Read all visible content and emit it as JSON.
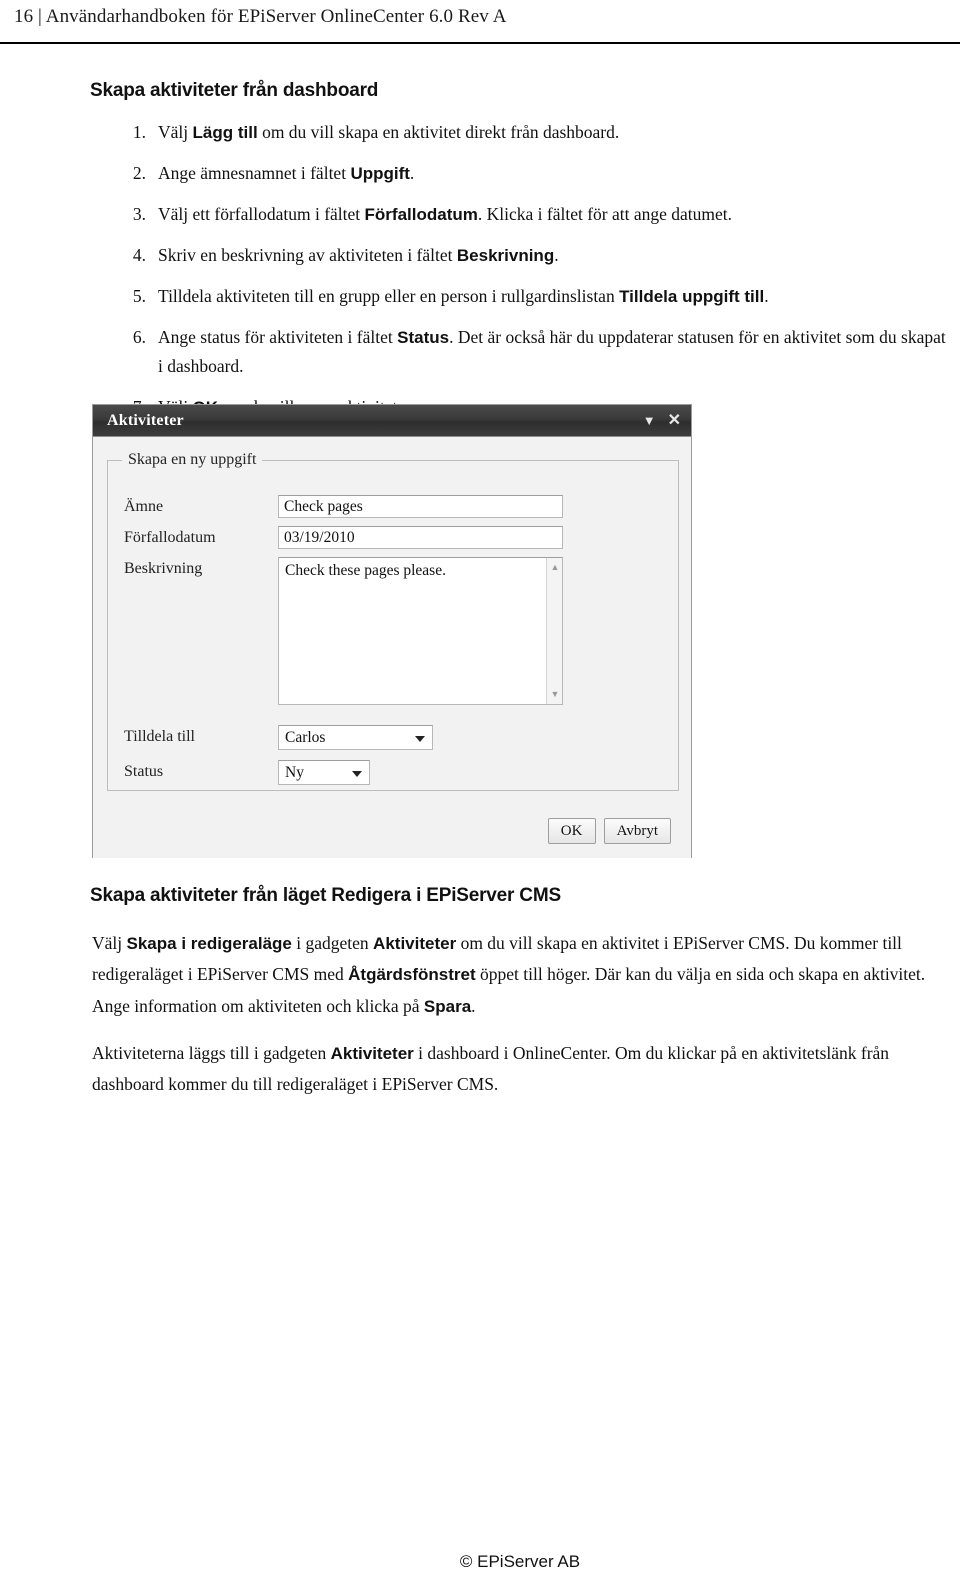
{
  "page": {
    "header": "16 | Användarhandboken för EPiServer OnlineCenter 6.0 Rev A",
    "footer": "© EPiServer AB"
  },
  "section1": {
    "heading": "Skapa aktiviteter från dashboard",
    "steps": [
      {
        "num": "1.",
        "html": "Välj <b>Lägg till</b> om du vill skapa en aktivitet direkt från dashboard."
      },
      {
        "num": "2.",
        "html": "Ange ämnesnamnet i fältet <b>Uppgift</b>."
      },
      {
        "num": "3.",
        "html": "Välj ett förfallodatum i fältet <b>Förfallodatum</b>. Klicka i fältet för att ange datumet."
      },
      {
        "num": "4.",
        "html": "Skriv en beskrivning av aktiviteten i fältet <b>Beskrivning</b>."
      },
      {
        "num": "5.",
        "html": "Tilldela aktiviteten till en grupp eller en person i rullgardinslistan <b>Tilldela uppgift till</b>."
      },
      {
        "num": "6.",
        "html": "Ange status för aktiviteten i fältet <b>Status</b>. Det är också här du uppdaterar statusen för en aktivitet som du skapat i dashboard."
      },
      {
        "num": "7.",
        "html": "Välj <b>OK</b> om du vill spara aktiviteten."
      }
    ]
  },
  "gadget": {
    "title": "Aktiviteter",
    "minimize_icon": "chevron-down-icon",
    "close_icon": "close-icon",
    "group_legend": "Skapa en ny uppgift",
    "fields": {
      "subject_label": "Ämne",
      "subject_value": "Check pages",
      "duedate_label": "Förfallodatum",
      "duedate_value": "03/19/2010",
      "description_label": "Beskrivning",
      "description_value": "Check these pages please.",
      "assign_label": "Tilldela till",
      "assign_value": "Carlos",
      "status_label": "Status",
      "status_value": "Ny"
    },
    "buttons": {
      "ok": "OK",
      "cancel": "Avbryt"
    }
  },
  "section2": {
    "heading": "Skapa aktiviteter från läget Redigera i EPiServer CMS",
    "paragraph1": "Välj <b>Skapa i redigeraläge</b> i gadgeten <b>Aktiviteter</b> om du vill skapa en aktivitet i EPiServer CMS. Du kommer till redigeraläget i EPiServer CMS med <b>Åtgärdsfönstret</b> öppet till höger. Där kan du välja en sida och skapa en aktivitet. Ange information om aktiviteten och klicka på <b>Spara</b>.",
    "paragraph2": "Aktiviteterna läggs till i gadgeten <b>Aktiviteter</b> i dashboard i OnlineCenter. Om du klickar på en aktivitetslänk från dashboard kommer du till redigeraläget i EPiServer CMS."
  }
}
